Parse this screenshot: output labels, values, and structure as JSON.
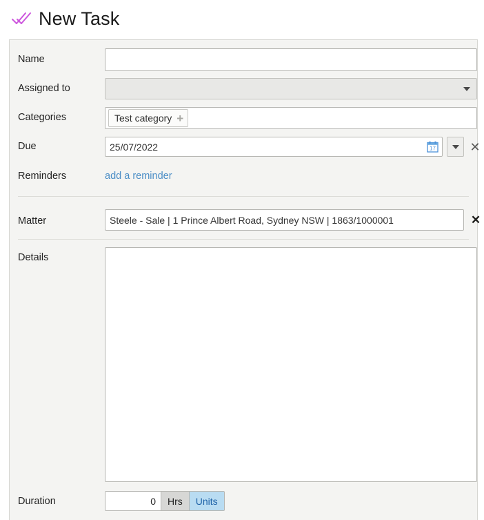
{
  "header": {
    "icon": "double-check-icon",
    "icon_color": "#cc55dd",
    "title": "New Task"
  },
  "form": {
    "name": {
      "label": "Name",
      "value": "",
      "placeholder": ""
    },
    "assigned_to": {
      "label": "Assigned to",
      "value": "",
      "placeholder": "",
      "icon": "chevron-down-icon"
    },
    "categories": {
      "label": "Categories",
      "chip_label": "Test category",
      "chip_add_icon": "plus-icon"
    },
    "due": {
      "label": "Due",
      "value": "25/07/2022",
      "placeholder": "",
      "calendar_icon": "calendar-icon",
      "calendar_day": "17",
      "dropdown_icon": "chevron-down-icon",
      "clear_icon": "close-icon"
    },
    "reminders": {
      "label": "Reminders",
      "link_text": "add a reminder"
    },
    "matter": {
      "label": "Matter",
      "value": "Steele - Sale | 1 Prince Albert Road, Sydney NSW | 1863/1000001",
      "placeholder": "",
      "clear_icon": "close-icon"
    },
    "details": {
      "label": "Details",
      "value": "",
      "placeholder": ""
    },
    "duration": {
      "label": "Duration",
      "value": "0",
      "unit_hrs": "Hrs",
      "unit_units": "Units",
      "selected_unit": "Units"
    }
  },
  "colors": {
    "accent_blue": "#4a8dc6",
    "selected_segment_bg": "#b9dcf2",
    "selected_segment_text": "#1f63a8",
    "panel_bg": "#f4f4f2",
    "icon_purple": "#cc55dd",
    "calendar_blue": "#4a90d9"
  }
}
